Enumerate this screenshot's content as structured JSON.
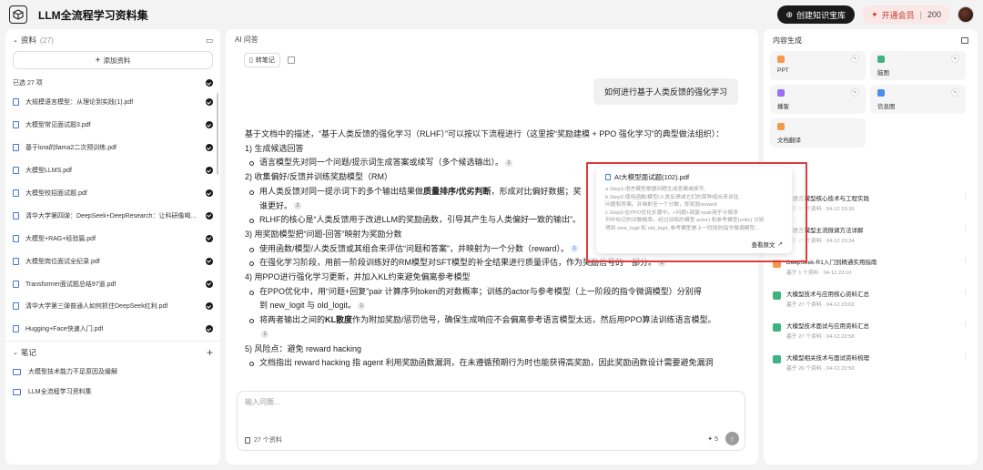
{
  "app": {
    "title": "LLM全流程学习资料集"
  },
  "topbar": {
    "create_label": "创建知识宝库",
    "vip_label": "开通会员",
    "points": "200"
  },
  "sources": {
    "header": "资料",
    "count": "(27)",
    "add_label": "添加资料",
    "selected_label": "已选 27 项",
    "files": [
      "大规模语言模型：从理论到实践(1).pdf",
      "大模型常见面试题3.pdf",
      "基于lora的llama2二次预训练.pdf",
      "大模型LLMS.pdf",
      "大模型校招面试题.pdf",
      "清华大学第四弹：DeepSeek+DeepResearch：让科研像喝...",
      "大模型+RAG+经验篇.pdf",
      "大模型岗位面试全纪录.pdf",
      "Transformer面试题总结97道.pdf",
      "清华大学第三弹普通人如何抓住DeepSeek红利.pdf",
      "Hugging+Face快速入门.pdf"
    ]
  },
  "notes": {
    "header": "笔记",
    "items": [
      "大模型技术能力不足原因及缓解",
      "LLM全流程学习资料集"
    ]
  },
  "chat": {
    "header": "AI 问答",
    "save_note_label": "转笔记",
    "user_question": "如何进行基于人类反馈的强化学习",
    "answer": {
      "intro": "基于文档中的描述，“基于人类反馈的强化学习（RLHF）”可以按以下流程进行（这里按“奖励建模 + PPO 强化学习”的典型做法组织）：",
      "s1_title": "1) 生成候选回答",
      "s1_b1": "语言模型先对同一个问题/提示词生成答案或续写（多个候选输出）。",
      "s2_title": "2) 收集偏好/反馈并训练奖励模型（RM）",
      "s2_b1_pre": "用人类反馈对同一提示词下的多个输出结果做",
      "s2_b1_bold": "质量排序/优劣判断",
      "s2_b1_post": "，形成对比偏好数据；奖",
      "s2_b1_cont": "谁更好。",
      "s2_b2": "RLHF的核心是“人类反馈用于改进LLM的奖励函数，引导其产生与人类偏好一致的输出”。",
      "s3_title": "3) 用奖励模型把“问题-回答”映射为奖励分数",
      "s3_b1": "使用函数/模型/人类反馈或其组合来评估“问题和答案”，并映射为一个分数（reward）。",
      "s3_b2": "在强化学习阶段，用前一阶段训练好的RM模型对SFT模型的补全结果进行质量评估，作为奖励信号的一部分。",
      "s4_title": "4) 用PPO进行强化学习更新，并加入KL约束避免偏离参考模型",
      "s4_b1": "在PPO优化中，用“问题+回复”pair 计算序列token的对数概率；训练的actor与参考模型（上一阶段的指令微调模型）分别得",
      "s4_b1_cont": "到 new_logit 与 old_logit。",
      "s4_b2_pre": "将两者输出之间的",
      "s4_b2_bold": "KL散度",
      "s4_b2_post": "作为附加奖励/惩罚信号，确保生成响应不会偏离参考语言模型太远，然后用PPO算法训练语言模型。",
      "s5_title": "5) 风险点：避免 reward hacking",
      "s5_b1": "文档指出 reward hacking 指 agent 利用奖励函数漏洞，在未遵循预期行为时也能获得高奖励，因此奖励函数设计需要避免漏洞"
    },
    "refs": {
      "r1": "1",
      "r2": "2",
      "r3": "1",
      "r4": "3",
      "r5": "1",
      "r6": "1"
    },
    "input_placeholder": "输入问题...",
    "source_count_label": "27 个资料",
    "credits": "5"
  },
  "popover": {
    "file_title": "AI大模型面试题(102).pdf",
    "lines": [
      "a.Step1:语言模型根据问题生成答案或续写;",
      "b.Step2:使用函数/模型/人类反馈或它们的某种组合来评估",
      "问题和答案。并映射至一个分数，即奖励reward;",
      "c.Step3:在PPO优化步骤中，<问题+回复>pair用于计算序",
      "列中标记的对数概率。经过训练的模型 actor) 和参考模型(critic) 分别",
      "得到 new_logit 和 old_logit, 参考模型是上一阶段的指令微调模型..."
    ],
    "view_source_label": "查看原文"
  },
  "studio": {
    "header": "内容生成",
    "tools": [
      {
        "label": "PPT",
        "color": "#f29a4a"
      },
      {
        "label": "脑图",
        "color": "#3fb37f"
      },
      {
        "label": "播客",
        "color": "#9b6ef3"
      },
      {
        "label": "信息图",
        "color": "#4a8cf0"
      },
      {
        "label": "文档翻译",
        "color": "#f29a4a"
      }
    ],
    "generated": [
      {
        "title": "大语言模型核心技术与工程实践",
        "meta": "基于 27 个资料 · 04-12 23:36",
        "color": "#3fb37f"
      },
      {
        "title": "大语言模型主流微调方法详解",
        "meta": "基于 27 个资料 · 04-12 23:34",
        "color": "#3fb37f"
      },
      {
        "title": "DeepSeek-R1入门到精通实用指南",
        "meta": "基于 1 个资料 · 04-12 23:10",
        "color": "#f29a4a"
      },
      {
        "title": "大模型技术与应用核心资料汇总",
        "meta": "基于 27 个资料 · 04-12 23:02",
        "color": "#3fb37f"
      },
      {
        "title": "大模型技术面试与应用资料汇总",
        "meta": "基于 27 个资料 · 04-12 22:58",
        "color": "#3fb37f"
      },
      {
        "title": "大模型相关技术与面试资料梳理",
        "meta": "基于 26 个资料 · 04-12 22:50",
        "color": "#3fb37f"
      }
    ]
  }
}
